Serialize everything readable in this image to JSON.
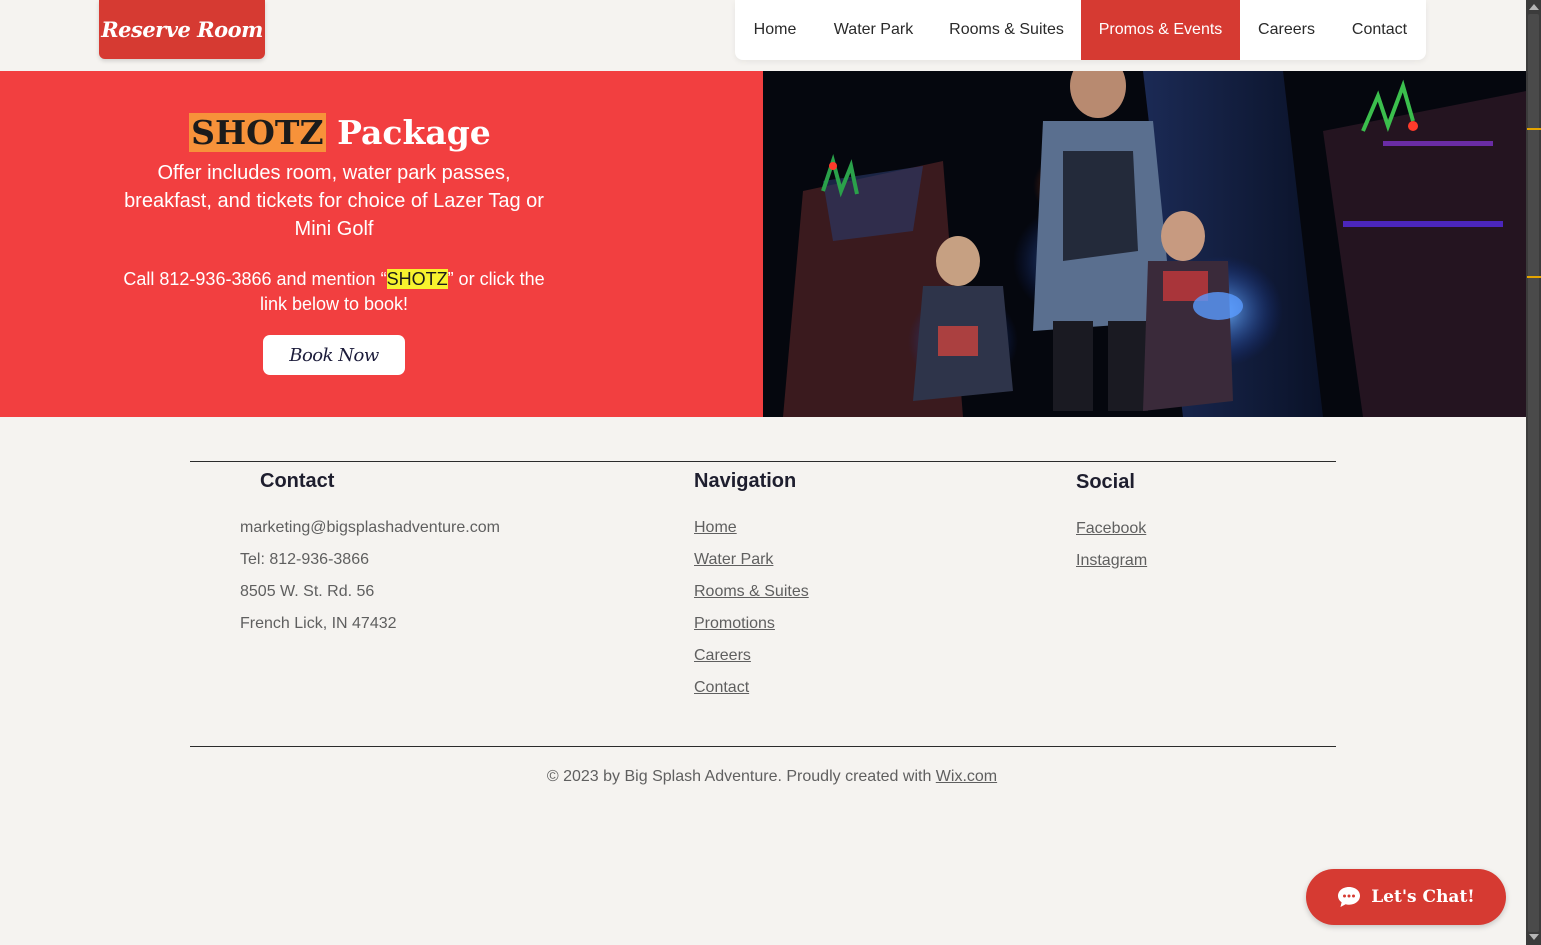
{
  "header": {
    "reserve_label": "Reserve Room",
    "nav": [
      {
        "label": "Home"
      },
      {
        "label": "Water Park"
      },
      {
        "label": "Rooms & Suites"
      },
      {
        "label": "Promos & Events",
        "active": true
      },
      {
        "label": "Careers"
      },
      {
        "label": "Contact"
      }
    ]
  },
  "hero": {
    "title_highlight": "SHOTZ",
    "title_rest": "Package",
    "description": "Offer includes room, water park passes, breakfast, and tickets for choice of Lazer Tag or Mini Golf",
    "call_prefix": "Call 812-936-3866 and mention “",
    "call_highlight": "SHOTZ",
    "call_suffix": "” or click the link below to book!",
    "book_label": "Book Now"
  },
  "footer": {
    "contact": {
      "heading": "Contact",
      "email": "marketing@bigsplashadventure.com",
      "tel": "Tel: 812-936-3866",
      "address1": "8505 W. St. Rd. 56",
      "address2": "French Lick, IN 47432"
    },
    "navigation": {
      "heading": "Navigation",
      "links": [
        "Home",
        "Water Park",
        "Rooms & Suites",
        "Promotions",
        "Careers",
        "Contact"
      ]
    },
    "social": {
      "heading": "Social",
      "links": [
        "Facebook",
        "Instagram"
      ]
    },
    "copyright_text": "© 2023 by Big Splash Adventure. Proudly created with ",
    "copyright_link": "Wix.com"
  },
  "chat": {
    "label": "Let's Chat!"
  },
  "colors": {
    "brand_red": "#d63a32",
    "hero_red": "#f23f40",
    "highlight_orange": "#f7923a",
    "highlight_yellow": "#f7f22e"
  }
}
